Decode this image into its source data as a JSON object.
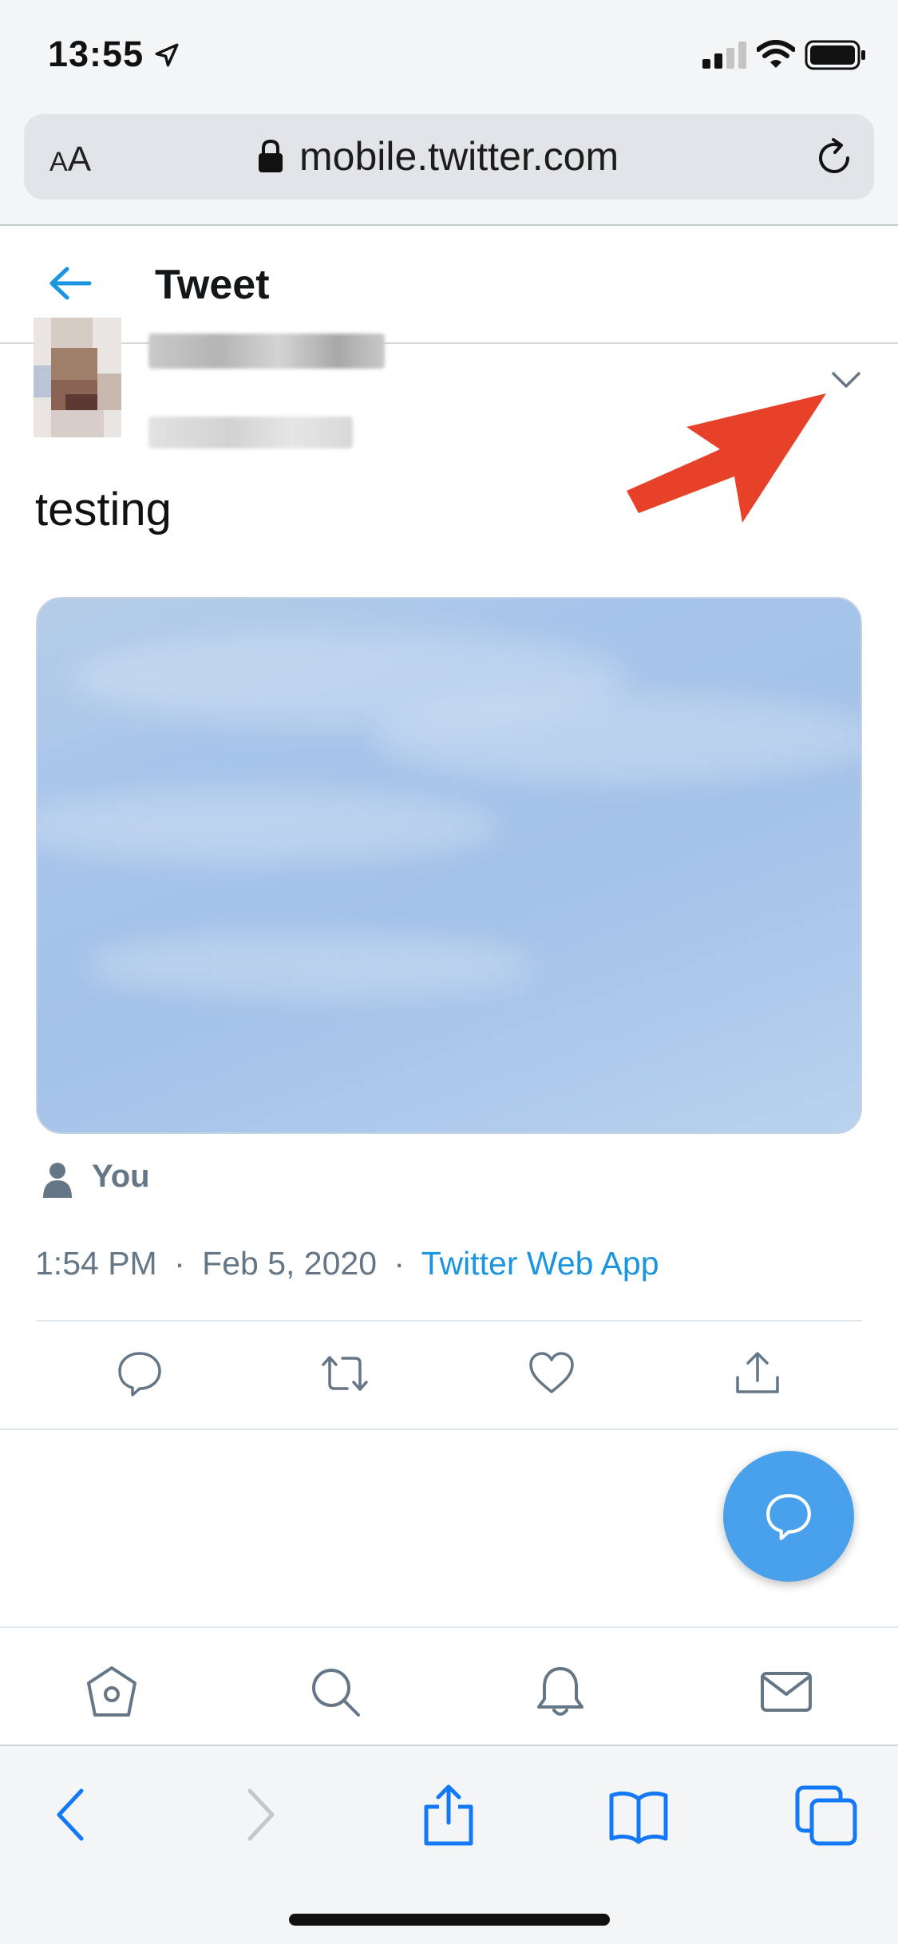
{
  "status_bar": {
    "time": "13:55",
    "icons": [
      "location-arrow-icon",
      "cellular-signal-icon",
      "wifi-icon",
      "battery-icon"
    ]
  },
  "safari": {
    "text_size_label_small": "A",
    "text_size_label_large": "A",
    "url": "mobile.twitter.com",
    "toolbar_icons": [
      "back-icon",
      "forward-icon",
      "share-icon",
      "bookmarks-icon",
      "tabs-icon"
    ]
  },
  "header": {
    "title": "Tweet"
  },
  "tweet": {
    "text": "testing",
    "audience_label": "You",
    "time": "1:54 PM",
    "separator": "·",
    "date": "Feb 5, 2020",
    "source": "Twitter Web App"
  },
  "actions": [
    "reply-icon",
    "retweet-icon",
    "like-icon",
    "share-icon"
  ],
  "bottom_nav": [
    "home-icon",
    "search-icon",
    "notifications-icon",
    "messages-icon"
  ],
  "colors": {
    "accent": "#1b95e0",
    "fab": "#4aa1eb",
    "muted": "#657786",
    "annotation_arrow": "#e8412a"
  }
}
